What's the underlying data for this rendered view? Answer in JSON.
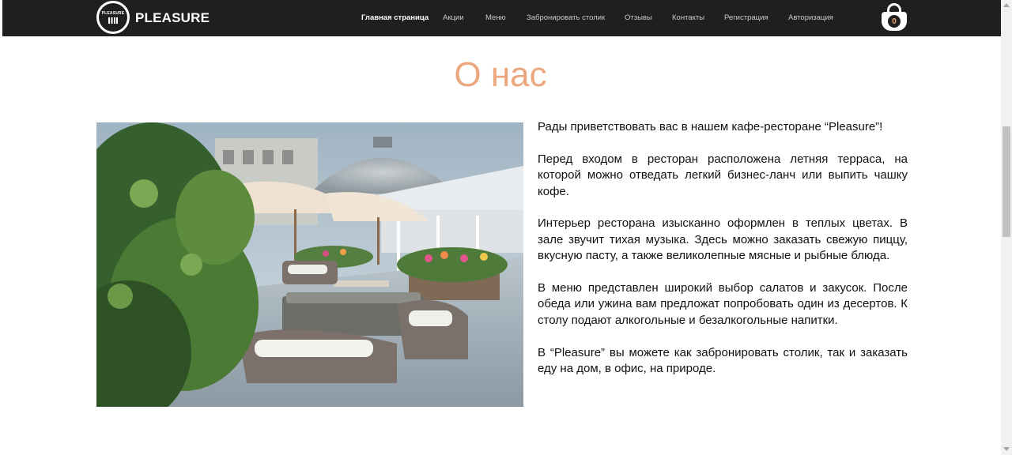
{
  "header": {
    "brand": "PLEASURE",
    "logo_text": "PLEASURE",
    "nav": [
      {
        "label": "Главная страница",
        "active": true
      },
      {
        "label": "Акции",
        "active": false
      },
      {
        "label": "Меню",
        "active": false
      },
      {
        "label": "Забронировать столик",
        "active": false
      },
      {
        "label": "Отзывы",
        "active": false
      },
      {
        "label": "Контакты",
        "active": false
      },
      {
        "label": "Регистрация",
        "active": false
      },
      {
        "label": "Авторизация",
        "active": false
      }
    ],
    "cart_count": "0",
    "cart_icon": "shopping-bag-icon"
  },
  "about": {
    "title": "О нас",
    "photo_icon": "restaurant-terrace-photo",
    "paragraphs": [
      "Рады приветствовать вас в нашем кафе-ресторане “Pleasure”!",
      "Перед входом в ресторан расположена летняя терраса, на которой можно отведать легкий бизнес-ланч или выпить чашку кофе.",
      "Интерьер ресторана изысканно оформлен в теплых цветах. В зале звучит тихая музыка. Здесь можно заказать свежую пиццу, вкусную пасту, а также великолепные мясные и рыбные блюда.",
      "В меню представлен широкий выбор салатов и закусок. После обеда или ужина вам предложат попробовать один из десертов. К столу подают алкогольные и безалкогольные напитки.",
      "В “Pleasure” вы можете как забронировать столик, так и заказать еду на дом, в офис, на природе."
    ]
  },
  "colors": {
    "header_bg": "#1f1f1f",
    "title_accent": "#eba77e",
    "cart_count_color": "#f3a76f"
  }
}
